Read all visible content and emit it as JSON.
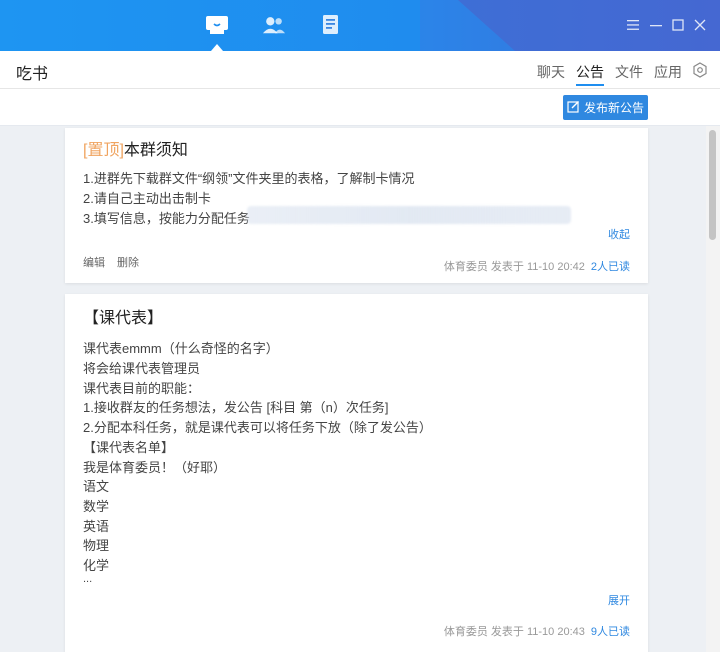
{
  "titlebar": {
    "icons": [
      "chat-icon",
      "contacts-icon",
      "file-icon"
    ],
    "controls": [
      "menu-icon",
      "minimize-icon",
      "maximize-icon",
      "close-icon"
    ]
  },
  "header": {
    "group_name": "吃书",
    "tabs": [
      {
        "label": "聊天"
      },
      {
        "label": "公告"
      },
      {
        "label": "文件"
      },
      {
        "label": "应用"
      }
    ],
    "active_tab": "公告"
  },
  "actions": {
    "post_label": "发布新公告"
  },
  "announcements": [
    {
      "pin_tag": "[置顶]",
      "title": "本群须知",
      "lines": [
        "1.进群先下载群文件“纲领”文件夹里的表格，了解制卡情况",
        "2.请自己主动出击制卡",
        "3.填写信息，按能力分配任务"
      ],
      "toggle_label": "收起",
      "edit_label": "编辑",
      "delete_label": "删除",
      "meta": "体育委员 发表于 11-10 20:42",
      "read": "2人已读"
    },
    {
      "title": "【课代表】",
      "lines": [
        "课代表emmm（什么奇怪的名字）",
        "将会给课代表管理员",
        "课代表目前的职能：",
        "1.接收群友的任务想法，发公告 [科目 第（n）次任务]",
        "2.分配本科任务，就是课代表可以将任务下放（除了发公告）",
        "【课代表名单】",
        "我是体育委员！（好耶）",
        "语文",
        "数学",
        "英语",
        "物理",
        "化学",
        "..."
      ],
      "toggle_label": "展开",
      "meta": "体育委员 发表于 11-10 20:43",
      "read": "9人已读"
    }
  ],
  "colors": {
    "accent": "#2f88e0",
    "titlebar": "#1f8ef0",
    "pin": "#f0a460"
  }
}
